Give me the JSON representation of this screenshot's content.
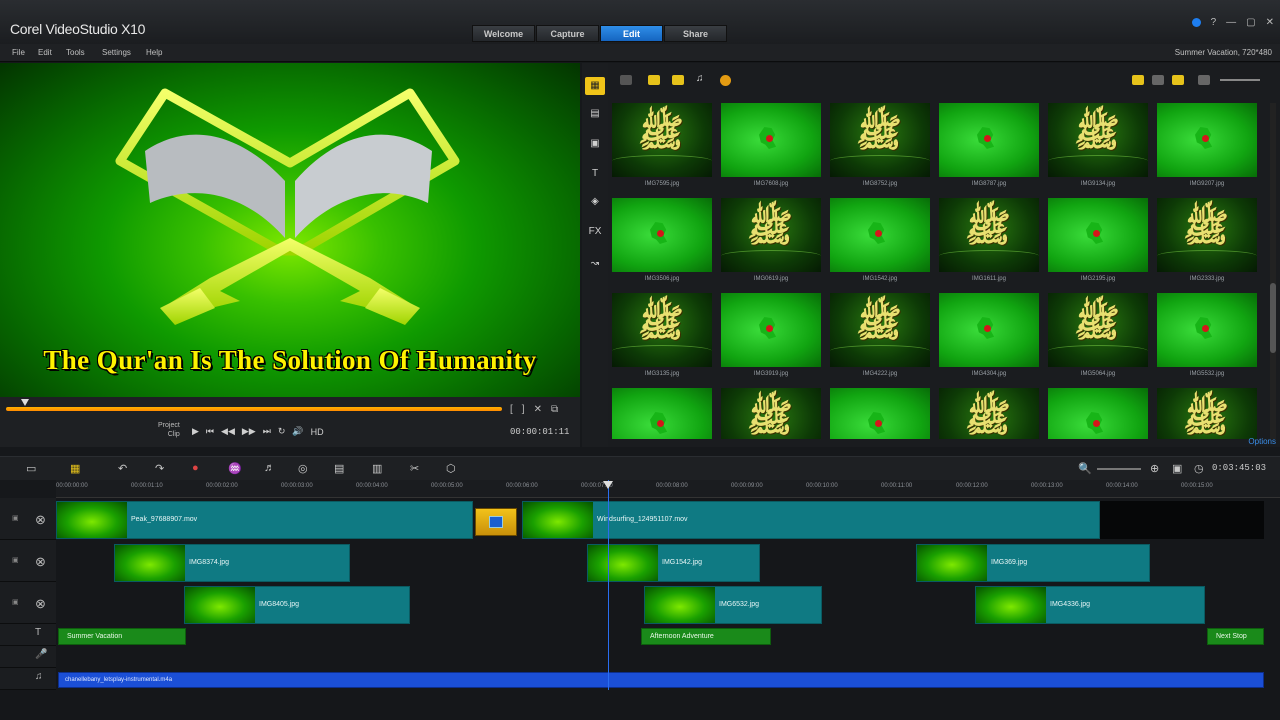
{
  "app": {
    "title": "Corel VideoStudio X10",
    "project_info": "Summer Vacation, 720*480"
  },
  "tabs": [
    {
      "label": "Welcome"
    },
    {
      "label": "Capture"
    },
    {
      "label": "Edit"
    },
    {
      "label": "Share"
    }
  ],
  "active_tab": "Edit",
  "menu": [
    "File",
    "Edit",
    "Tools",
    "Settings",
    "Help"
  ],
  "preview": {
    "caption": "The Qur'an Is The Solution Of Humanity",
    "mode_label": "Project",
    "mode_sub": "Clip",
    "timecode": "00:00:01:11",
    "hd_label": "HD"
  },
  "library": {
    "options_label": "Options",
    "thumbnails": [
      {
        "name": "IMG7595.jpg",
        "style": "dark"
      },
      {
        "name": "IMG7608.jpg",
        "style": "green"
      },
      {
        "name": "IMG8752.jpg",
        "style": "dark"
      },
      {
        "name": "IMG8787.jpg",
        "style": "green"
      },
      {
        "name": "IMG9134.jpg",
        "style": "dark"
      },
      {
        "name": "IMG9207.jpg",
        "style": "green"
      },
      {
        "name": "IMG3506.jpg",
        "style": "green"
      },
      {
        "name": "IMG0619.jpg",
        "style": "dark"
      },
      {
        "name": "IMG1542.jpg",
        "style": "green"
      },
      {
        "name": "IMG1611.jpg",
        "style": "dark"
      },
      {
        "name": "IMG2195.jpg",
        "style": "green"
      },
      {
        "name": "IMG2333.jpg",
        "style": "dark"
      },
      {
        "name": "IMG3135.jpg",
        "style": "dark"
      },
      {
        "name": "IMG3919.jpg",
        "style": "green"
      },
      {
        "name": "IMG4222.jpg",
        "style": "dark"
      },
      {
        "name": "IMG4304.jpg",
        "style": "green"
      },
      {
        "name": "IMG5064.jpg",
        "style": "dark"
      },
      {
        "name": "IMG5532.jpg",
        "style": "green"
      },
      {
        "name": "",
        "style": "green"
      },
      {
        "name": "",
        "style": "dark"
      },
      {
        "name": "",
        "style": "green"
      },
      {
        "name": "",
        "style": "dark"
      },
      {
        "name": "",
        "style": "green"
      },
      {
        "name": "",
        "style": "dark"
      }
    ]
  },
  "timeline": {
    "timecode": "0:03:45:03",
    "ruler": [
      "00:00:00:00",
      "00:00:01:10",
      "00:00:02:00",
      "00:00:03:00",
      "00:00:04:00",
      "00:00:05:00",
      "00:00:06:00",
      "00:00:07:00",
      "00:00:08:00",
      "00:00:09:00",
      "00:00:10:00",
      "00:00:11:00",
      "00:00:12:00",
      "00:00:13:00",
      "00:00:14:00",
      "00:00:15:00"
    ],
    "video_clips": [
      {
        "name": "Peak_97688907.mov"
      },
      {
        "name": "Windsurfing_124951107.mov"
      }
    ],
    "overlay1": [
      {
        "name": "IMG8374.jpg"
      },
      {
        "name": "IMG1542.jpg"
      },
      {
        "name": "IMG369.jpg"
      }
    ],
    "overlay2": [
      {
        "name": "IMG8405.jpg"
      },
      {
        "name": "IMG6532.jpg"
      },
      {
        "name": "IMG4336.jpg"
      }
    ],
    "titles": [
      {
        "name": "Summer Vacation"
      },
      {
        "name": "Afternoon Adventure"
      },
      {
        "name": "Next Stop"
      }
    ],
    "music": {
      "name": "chanellebany_letsplay-instrumental.m4a"
    }
  }
}
